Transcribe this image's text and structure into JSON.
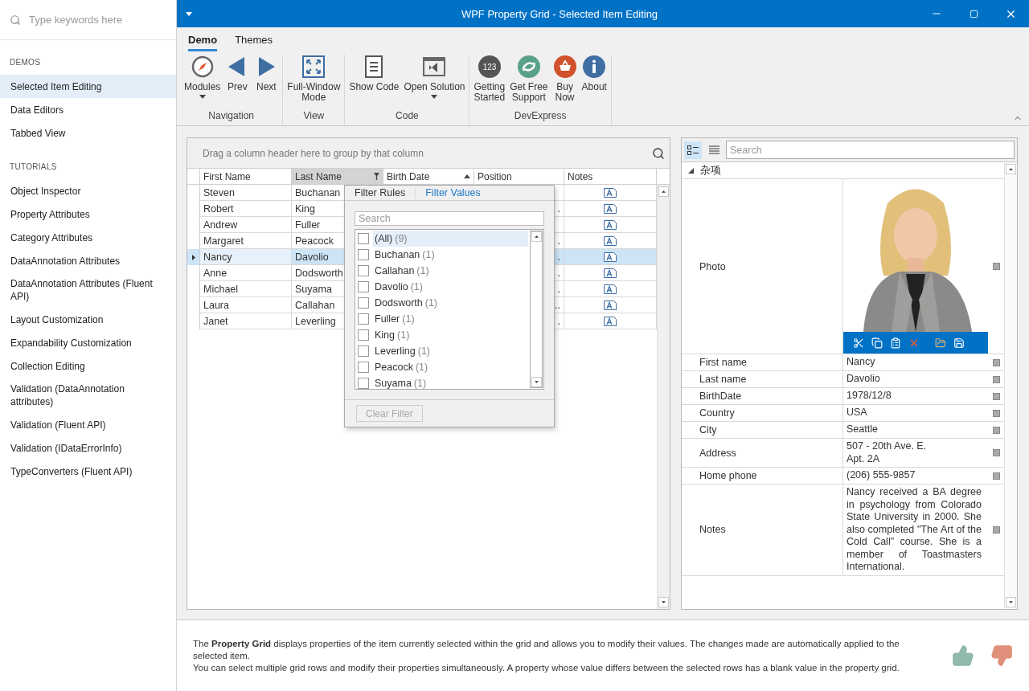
{
  "sidebar": {
    "search": {
      "placeholder": "Type keywords here"
    },
    "sections": [
      {
        "title": "DEMOS",
        "items": [
          {
            "label": "Selected Item Editing",
            "selected": true
          },
          {
            "label": "Data Editors",
            "selected": false
          },
          {
            "label": "Tabbed View",
            "selected": false
          }
        ]
      },
      {
        "title": "TUTORIALS",
        "items": [
          {
            "label": "Object Inspector",
            "selected": false
          },
          {
            "label": "Property Attributes",
            "selected": false
          },
          {
            "label": "Category Attributes",
            "selected": false
          },
          {
            "label": "DataAnnotation Attributes",
            "selected": false
          },
          {
            "label": "DataAnnotation Attributes (Fluent API)",
            "selected": false
          },
          {
            "label": "Layout Customization",
            "selected": false
          },
          {
            "label": "Expandability Customization",
            "selected": false
          },
          {
            "label": "Collection Editing",
            "selected": false
          },
          {
            "label": "Validation (DataAnnotation attributes)",
            "selected": false
          },
          {
            "label": "Validation (Fluent API)",
            "selected": false
          },
          {
            "label": "Validation (IDataErrorInfo)",
            "selected": false
          },
          {
            "label": "TypeConverters (Fluent API)",
            "selected": false
          }
        ]
      }
    ]
  },
  "window": {
    "title": "WPF Property Grid - Selected Item Editing"
  },
  "ribbon": {
    "tabs": [
      {
        "label": "Demo",
        "selected": true
      },
      {
        "label": "Themes",
        "selected": false
      }
    ],
    "groups": [
      {
        "label": "Navigation",
        "buttons": [
          {
            "kind": "compass",
            "lines": [
              "Modules"
            ],
            "dropdown": true
          },
          {
            "kind": "prev",
            "lines": [
              "Prev"
            ],
            "dropdown": false
          },
          {
            "kind": "next",
            "lines": [
              "Next"
            ],
            "dropdown": false
          }
        ]
      },
      {
        "label": "View",
        "buttons": [
          {
            "kind": "fullscreen",
            "lines": [
              "Full-Window",
              "Mode"
            ],
            "dropdown": false
          }
        ]
      },
      {
        "label": "Code",
        "buttons": [
          {
            "kind": "document",
            "lines": [
              "Show Code"
            ],
            "dropdown": false
          },
          {
            "kind": "solution",
            "lines": [
              "Open Solution"
            ],
            "dropdown": true
          }
        ]
      },
      {
        "label": "DevExpress",
        "buttons": [
          {
            "kind": "numbers",
            "icon_text": "123",
            "lines": [
              "Getting",
              "Started"
            ],
            "dropdown": false
          },
          {
            "kind": "support",
            "lines": [
              "Get Free",
              "Support"
            ],
            "dropdown": false
          },
          {
            "kind": "basket",
            "lines": [
              "Buy",
              "Now"
            ],
            "dropdown": false
          },
          {
            "kind": "info",
            "lines": [
              "About"
            ],
            "dropdown": false
          }
        ]
      }
    ]
  },
  "grid": {
    "group_panel": "Drag a column header here to group by that column",
    "columns": [
      {
        "label": "First Name",
        "filtered": false,
        "sorted": false
      },
      {
        "label": "Last Name",
        "filtered": true,
        "sorted": false
      },
      {
        "label": "Birth Date",
        "filtered": false,
        "sorted": true
      },
      {
        "label": "Position",
        "filtered": false,
        "sorted": false
      },
      {
        "label": "Notes",
        "filtered": false,
        "sorted": false
      }
    ],
    "rows": [
      {
        "first": "Steven",
        "last": "Buchanan",
        "selected": false
      },
      {
        "first": "Robert",
        "last": "King",
        "position_tail": ".",
        "selected": false
      },
      {
        "first": "Andrew",
        "last": "Fuller",
        "selected": false
      },
      {
        "first": "Margaret",
        "last": "Peacock",
        "position_tail": ".",
        "selected": false
      },
      {
        "first": "Nancy",
        "last": "Davolio",
        "position_tail": ".",
        "selected": true
      },
      {
        "first": "Anne",
        "last": "Dodsworth",
        "position_tail": ".",
        "selected": false
      },
      {
        "first": "Michael",
        "last": "Suyama",
        "position_tail": ".",
        "selected": false
      },
      {
        "first": "Laura",
        "last": "Callahan",
        "position_tail": "..",
        "selected": false
      },
      {
        "first": "Janet",
        "last": "Leverling",
        "position_tail": ".",
        "selected": false
      }
    ]
  },
  "filter_popup": {
    "tabs": [
      {
        "label": "Filter Rules",
        "selected": false
      },
      {
        "label": "Filter Values",
        "selected": true
      }
    ],
    "search": {
      "placeholder": "Search"
    },
    "items": [
      {
        "label": "(All)",
        "count": "(9)",
        "checked": false,
        "selected": true
      },
      {
        "label": "Buchanan",
        "count": "(1)",
        "checked": false,
        "selected": false
      },
      {
        "label": "Callahan",
        "count": "(1)",
        "checked": false,
        "selected": false
      },
      {
        "label": "Davolio",
        "count": "(1)",
        "checked": false,
        "selected": false
      },
      {
        "label": "Dodsworth",
        "count": "(1)",
        "checked": false,
        "selected": false
      },
      {
        "label": "Fuller",
        "count": "(1)",
        "checked": false,
        "selected": false
      },
      {
        "label": "King",
        "count": "(1)",
        "checked": false,
        "selected": false
      },
      {
        "label": "Leverling",
        "count": "(1)",
        "checked": false,
        "selected": false
      },
      {
        "label": "Peacock",
        "count": "(1)",
        "checked": false,
        "selected": false
      },
      {
        "label": "Suyama",
        "count": "(1)",
        "checked": false,
        "selected": false
      }
    ],
    "clear_button": {
      "label": "Clear Filter",
      "disabled": true
    }
  },
  "property_grid": {
    "views": [
      {
        "kind": "categorized",
        "selected": true
      },
      {
        "kind": "alphabetical",
        "selected": false
      }
    ],
    "search": {
      "placeholder": "Search"
    },
    "category": {
      "label": "杂项",
      "expanded": true
    },
    "rows": [
      {
        "name": "Photo"
      },
      {
        "kind": "text",
        "name": "First name",
        "lines": [
          "Nancy"
        ]
      },
      {
        "kind": "text",
        "name": "Last name",
        "lines": [
          "Davolio"
        ]
      },
      {
        "kind": "text",
        "name": "BirthDate",
        "lines": [
          "1978/12/8"
        ]
      },
      {
        "kind": "text",
        "name": "Country",
        "lines": [
          "USA"
        ]
      },
      {
        "kind": "text",
        "name": "City",
        "lines": [
          "Seattle"
        ]
      },
      {
        "kind": "text",
        "name": "Address",
        "lines": [
          "507 - 20th Ave. E.",
          "Apt. 2A"
        ]
      },
      {
        "kind": "text",
        "name": "Home phone",
        "lines": [
          "(206) 555-9857"
        ]
      },
      {
        "kind": "memo",
        "name": "Notes",
        "lines": [
          "Nancy received a BA degree in psychology from Colorado State University in 2000. She also completed \"The Art of the Cold Call\" course. She is a member of Toastmasters International."
        ]
      }
    ]
  },
  "description": {
    "paragraphs": [
      "The **Property Grid** displays properties of the item currently selected within the grid and allows you to modify their values. The changes made are automatically applied to the selected item.",
      "You can select multiple grid rows and modify their properties simultaneously. A property whose value differs between the selected rows has a blank value in the property grid."
    ]
  }
}
